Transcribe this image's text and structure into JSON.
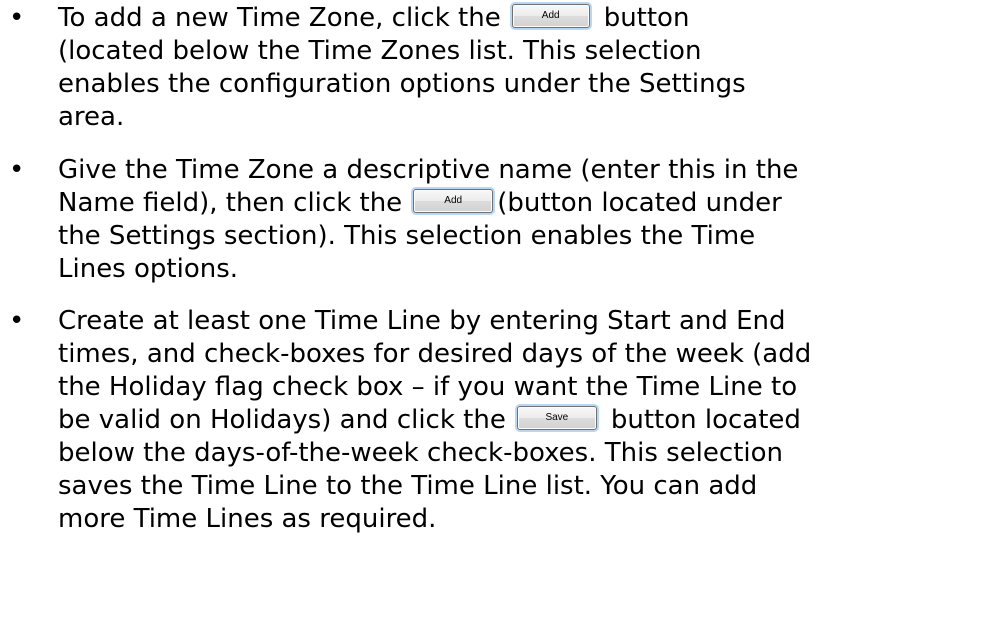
{
  "instructions": [
    {
      "lines": [
        [
          "To add a new Time Zone, click the",
          {
            "button": "Add"
          },
          "button"
        ],
        [
          "(located below the Time Zones list.  This selection"
        ],
        [
          "enables the configuration options under the Settings"
        ],
        [
          "area."
        ]
      ]
    },
    {
      "lines": [
        [
          "Give the Time Zone a descriptive name (enter this in the"
        ],
        [
          "Name field), then click the",
          {
            "button": "Add"
          },
          "(button located under"
        ],
        [
          "the Settings section).  This selection enables the Time"
        ],
        [
          "Lines options."
        ]
      ]
    },
    {
      "lines": [
        [
          "Create at least one Time Line by entering Start and End"
        ],
        [
          "times, and check-boxes for desired days of the week (add"
        ],
        [
          "the Holiday flag check box – if you want the Time Line to"
        ],
        [
          "be valid on Holidays) and click the",
          {
            "button": "Save"
          },
          "button located"
        ],
        [
          "below the days-of-the-week check-boxes.  This selection"
        ],
        [
          "saves the Time Line to the Time Line list.  You can add"
        ],
        [
          "more Time Lines as required."
        ]
      ]
    }
  ],
  "bullet_glyph": "•"
}
